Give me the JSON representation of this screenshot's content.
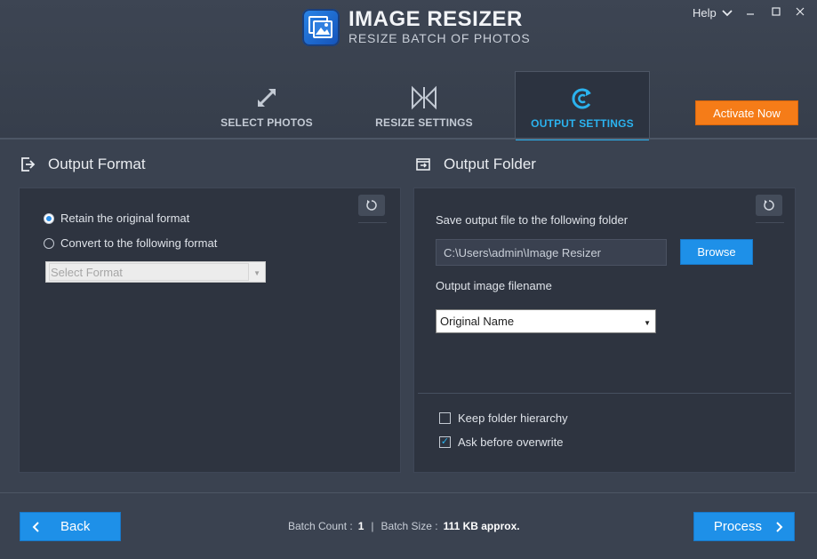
{
  "app": {
    "title": "IMAGE RESIZER",
    "subtitle": "RESIZE BATCH OF PHOTOS",
    "help_label": "Help"
  },
  "tabs": [
    {
      "label": "SELECT PHOTOS",
      "icon": "expand-arrows-icon",
      "active": false
    },
    {
      "label": "RESIZE SETTINGS",
      "icon": "resize-settings-icon",
      "active": false
    },
    {
      "label": "OUTPUT SETTINGS",
      "icon": "output-settings-icon",
      "active": true
    }
  ],
  "activate_label": "Activate Now",
  "output_format": {
    "title": "Output Format",
    "retain_label": "Retain the original format",
    "convert_label": "Convert to the following format",
    "format_placeholder": "Select Format",
    "selected_option": "retain"
  },
  "output_folder": {
    "title": "Output Folder",
    "save_label": "Save output file to the following folder",
    "path": "C:\\Users\\admin\\Image Resizer",
    "browse_label": "Browse",
    "filename_label": "Output image filename",
    "filename_value": "Original Name",
    "keep_hierarchy_label": "Keep folder hierarchy",
    "keep_hierarchy_checked": false,
    "ask_overwrite_label": "Ask before overwrite",
    "ask_overwrite_checked": true
  },
  "footer": {
    "back_label": "Back",
    "process_label": "Process",
    "batch_count_label": "Batch Count :",
    "batch_count_value": "1",
    "separator": "|",
    "batch_size_label": "Batch Size :",
    "batch_size_value": "111 KB approx."
  },
  "colors": {
    "accent": "#2bb3ef",
    "button_blue": "#1e90e8",
    "activate_orange": "#f57c18",
    "background": "#3a4250",
    "panel": "#2e3440"
  }
}
